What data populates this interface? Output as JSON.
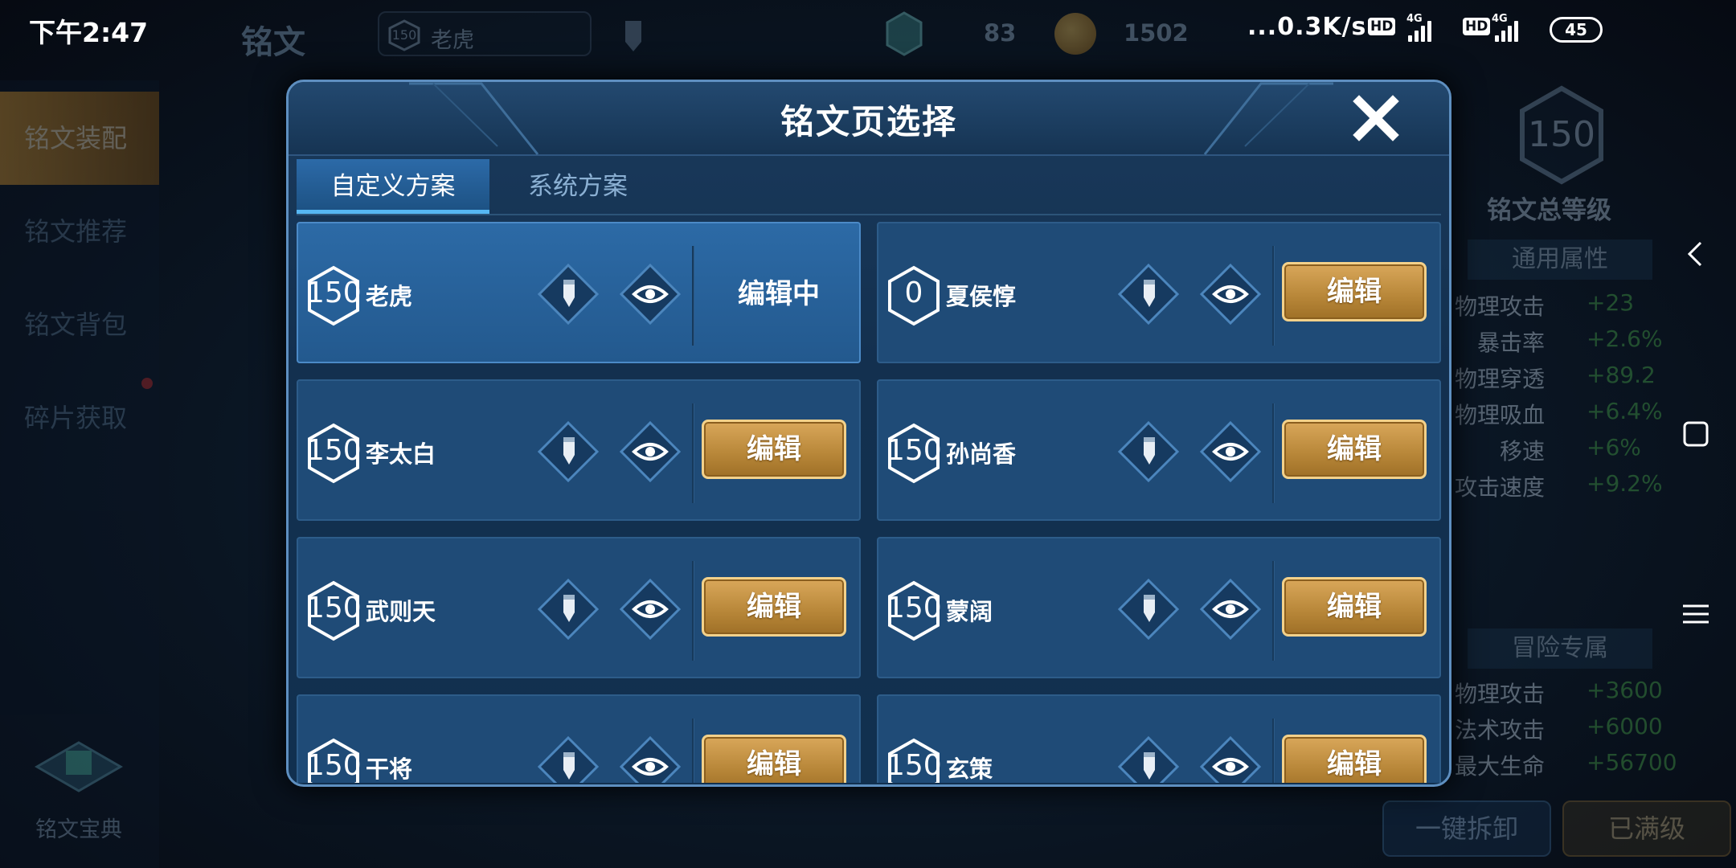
{
  "status_bar": {
    "time": "下午2:47",
    "net_speed": "...0.3K/s",
    "hd": "HD",
    "network": "4G",
    "battery": "45"
  },
  "background": {
    "title": "铭文",
    "selected_page": {
      "level": "150",
      "name": "老虎"
    },
    "gem_count": "83",
    "coin_count": "1502",
    "sidebar": [
      "铭文装配",
      "铭文推荐",
      "铭文背包",
      "碎片获取"
    ],
    "codex_label": "铭文宝典",
    "total_level": "150",
    "total_level_label": "铭文总等级",
    "general_section": "通用属性",
    "general_stats": [
      {
        "k": "物理攻击",
        "v": "+23"
      },
      {
        "k": "暴击率",
        "v": "+2.6%"
      },
      {
        "k": "物理穿透",
        "v": "+89.2"
      },
      {
        "k": "物理吸血",
        "v": "+6.4%"
      },
      {
        "k": "移速",
        "v": "+6%"
      },
      {
        "k": "攻击速度",
        "v": "+9.2%"
      }
    ],
    "adventure_section": "冒险专属",
    "adventure_stats": [
      {
        "k": "物理攻击",
        "v": "+3600"
      },
      {
        "k": "法术攻击",
        "v": "+6000"
      },
      {
        "k": "最大生命",
        "v": "+56700"
      }
    ],
    "btn_dismantle": "一键拆卸",
    "btn_maxed": "已满级"
  },
  "modal": {
    "title": "铭文页选择",
    "tabs": [
      "自定义方案",
      "系统方案"
    ],
    "active_tab": "自定义方案",
    "editing_label": "编辑中",
    "edit_label": "编辑",
    "pages": [
      {
        "level": "150",
        "name": "老虎",
        "editing": true
      },
      {
        "level": "0",
        "name": "夏侯惇",
        "editing": false
      },
      {
        "level": "150",
        "name": "李太白",
        "editing": false
      },
      {
        "level": "150",
        "name": "孙尚香",
        "editing": false
      },
      {
        "level": "150",
        "name": "武则天",
        "editing": false
      },
      {
        "level": "150",
        "name": "蒙阔",
        "editing": false
      },
      {
        "level": "150",
        "name": "干将",
        "editing": false
      },
      {
        "level": "150",
        "name": "玄策",
        "editing": false
      }
    ]
  },
  "colors": {
    "accent_gold": "#c9954a",
    "panel_blue": "#1f4b77",
    "active_blue": "#2c6aa6",
    "stat_green": "#4cb04c"
  }
}
